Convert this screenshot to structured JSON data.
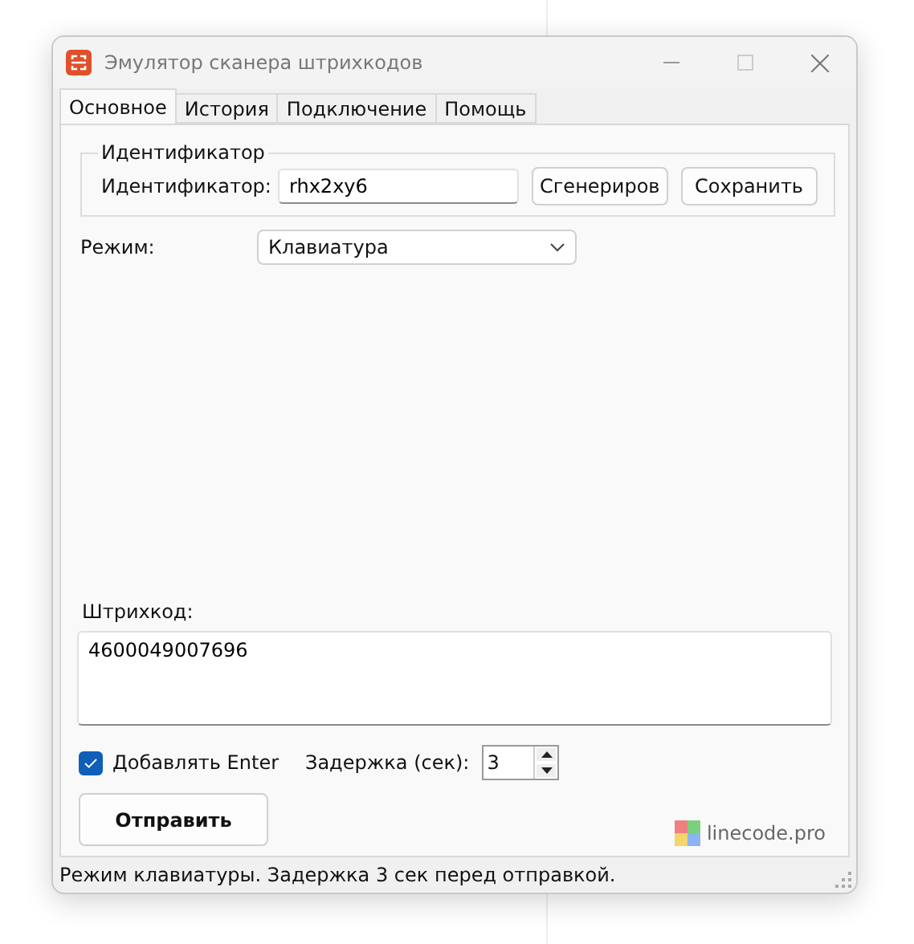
{
  "window": {
    "title": "Эмулятор сканера штрихкодов"
  },
  "tabs": [
    {
      "label": "Основное",
      "selected": true
    },
    {
      "label": "История",
      "selected": false
    },
    {
      "label": "Подключение",
      "selected": false
    },
    {
      "label": "Помощь",
      "selected": false
    }
  ],
  "identifier_group": {
    "title": "Идентификатор",
    "label": "Идентификатор:",
    "value": "rhx2xy6",
    "buttons": [
      "Сгенериров",
      "Сохранить"
    ]
  },
  "mode": {
    "label": "Режим:",
    "value": "Клавиатура"
  },
  "barcode": {
    "label": "Штрихкод:",
    "value": "4600049007696"
  },
  "add_enter": {
    "label": "Добавлять Enter",
    "checked": true
  },
  "delay": {
    "label": "Задержка (сек):",
    "value": "3"
  },
  "send_button": "Отправить",
  "brand": "linecode.pro",
  "status_bar": "Режим клавиатуры. Задержка 3 сек перед отправкой."
}
